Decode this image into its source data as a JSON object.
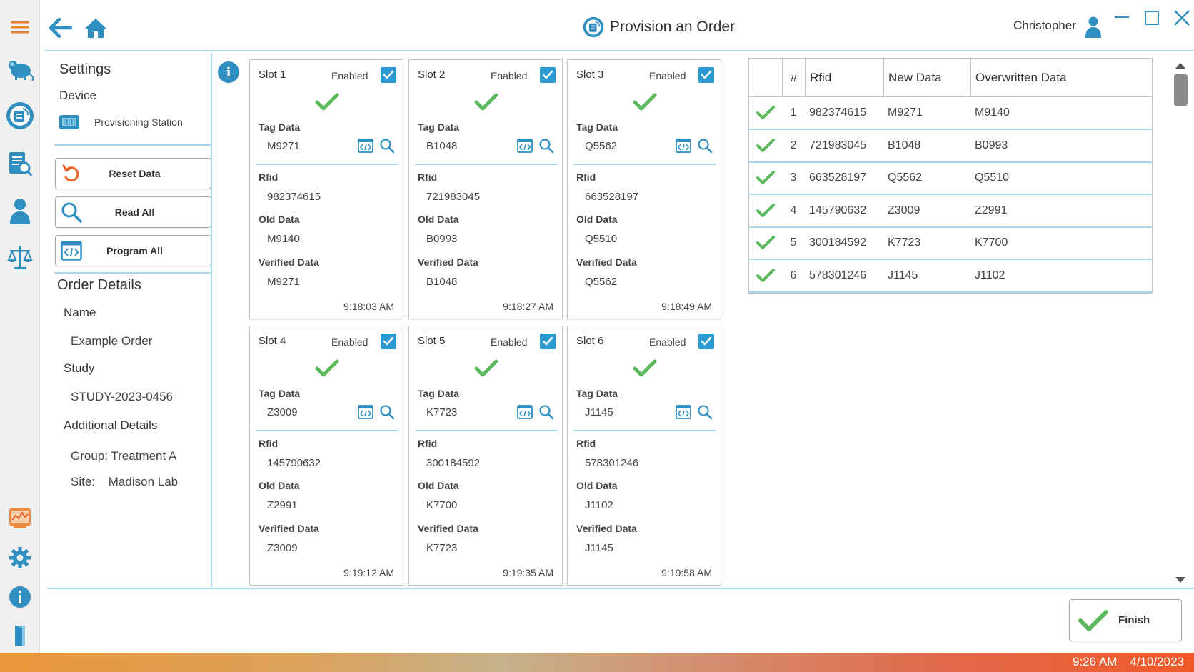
{
  "header": {
    "title": "Provision an Order",
    "user_name": "Christopher"
  },
  "settings": {
    "title": "Settings",
    "device_label": "Device",
    "station_name": "Provisioning Station",
    "buttons": {
      "reset": "Reset Data",
      "read_all": "Read All",
      "program_all": "Program All"
    },
    "order_details": {
      "title": "Order Details",
      "name_label": "Name",
      "name_value": "Example Order",
      "study_label": "Study",
      "study_value": "STUDY-2023-0456",
      "additional_label": "Additional Details",
      "group_value": "Group: Treatment A",
      "site_label": "Site:",
      "site_value": "Madison Lab"
    }
  },
  "labels": {
    "enabled": "Enabled",
    "tag_data": "Tag Data",
    "rfid": "Rfid",
    "old_data": "Old Data",
    "verified_data": "Verified Data"
  },
  "slots": [
    {
      "name": "Slot 1",
      "tag": "M9271",
      "rfid": "982374615",
      "old": "M9140",
      "verified": "M9271",
      "time": "9:18:03 AM"
    },
    {
      "name": "Slot 2",
      "tag": "B1048",
      "rfid": "721983045",
      "old": "B0993",
      "verified": "B1048",
      "time": "9:18:27 AM"
    },
    {
      "name": "Slot 3",
      "tag": "Q5562",
      "rfid": "663528197",
      "old": "Q5510",
      "verified": "Q5562",
      "time": "9:18:49 AM"
    },
    {
      "name": "Slot 4",
      "tag": "Z3009",
      "rfid": "145790632",
      "old": "Z2991",
      "verified": "Z3009",
      "time": "9:19:12 AM"
    },
    {
      "name": "Slot 5",
      "tag": "K7723",
      "rfid": "300184592",
      "old": "K7700",
      "verified": "K7723",
      "time": "9:19:35 AM"
    },
    {
      "name": "Slot 6",
      "tag": "J1145",
      "rfid": "578301246",
      "old": "J1102",
      "verified": "J1145",
      "time": "9:19:58 AM"
    }
  ],
  "table": {
    "headers": [
      "#",
      "Rfid",
      "New Data",
      "Overwritten Data"
    ],
    "rows": [
      {
        "num": "1",
        "rfid": "982374615",
        "new": "M9271",
        "old": "M9140"
      },
      {
        "num": "2",
        "rfid": "721983045",
        "new": "B1048",
        "old": "B0993"
      },
      {
        "num": "3",
        "rfid": "663528197",
        "new": "Q5562",
        "old": "Q5510"
      },
      {
        "num": "4",
        "rfid": "145790632",
        "new": "Z3009",
        "old": "Z2991"
      },
      {
        "num": "5",
        "rfid": "300184592",
        "new": "K7723",
        "old": "K7700"
      },
      {
        "num": "6",
        "rfid": "578301246",
        "new": "J1145",
        "old": "J1102"
      }
    ]
  },
  "footer": {
    "finish_label": "Finish"
  },
  "taskbar": {
    "time": "9:26 AM",
    "date": "4/10/2023"
  },
  "colors": {
    "accent": "#2b9ad0",
    "divider": "#a9d8ea",
    "success": "#5cb85c",
    "reset_icon": "#e8632a",
    "report_icon": "#f08a3a"
  }
}
